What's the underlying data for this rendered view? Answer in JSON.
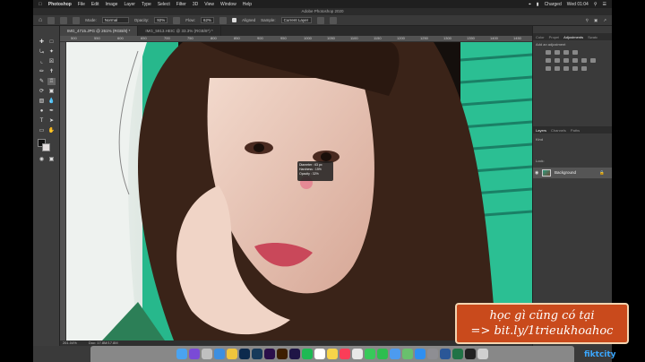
{
  "menubar": {
    "app": "Photoshop",
    "items": [
      "File",
      "Edit",
      "Image",
      "Layer",
      "Type",
      "Select",
      "Filter",
      "3D",
      "View",
      "Window",
      "Help"
    ],
    "battery": "Charged",
    "clock": "Wed 01:04"
  },
  "window_title": "Adobe Photoshop 2020",
  "options": {
    "mode_label": "Mode:",
    "mode_value": "Normal",
    "opacity_label": "Opacity:",
    "opacity_value": "92%",
    "flow_label": "Flow:",
    "flow_value": "62%",
    "aligned_label": "Aligned",
    "sample_label": "Sample:",
    "sample_value": "Current Layer"
  },
  "doc_tabs": [
    {
      "label": "IMG_4715.JPG @ 261% (RGB/8) *",
      "active": true
    },
    {
      "label": "IMG_5913.HEIC @ 33.3% (RGB/8*) *",
      "active": false
    }
  ],
  "ruler_ticks": [
    "500",
    "550",
    "600",
    "650",
    "700",
    "750",
    "800",
    "850",
    "900",
    "950",
    "1000",
    "1050",
    "1100",
    "1150",
    "1200",
    "1250",
    "1300",
    "1350",
    "1400",
    "1450"
  ],
  "brush_tip": {
    "diameter": "Diameter : 63 px",
    "hardness": "Hardness : 15%",
    "opacity": "Opacity : 32%"
  },
  "status": {
    "zoom": "261.04%",
    "doc": "Doc: 17.8M/17.8M"
  },
  "panels": {
    "top_tabs": [
      "Color",
      "Propei",
      "Adjustments",
      "Swatc"
    ],
    "adjust_hint": "Add an adjustment",
    "layer_tabs": [
      "Layers",
      "Channels",
      "Paths"
    ],
    "kind_label": "Kind",
    "lock_label": "Lock:",
    "layer_name": "Background"
  },
  "promo": {
    "line1": "học gì cũng có tại",
    "line2": "=> bit.ly/1trieukhoahoc"
  },
  "brand": "fiktcity",
  "colors": {
    "accent": "#c94a1c",
    "brand": "#3aa7ff"
  }
}
